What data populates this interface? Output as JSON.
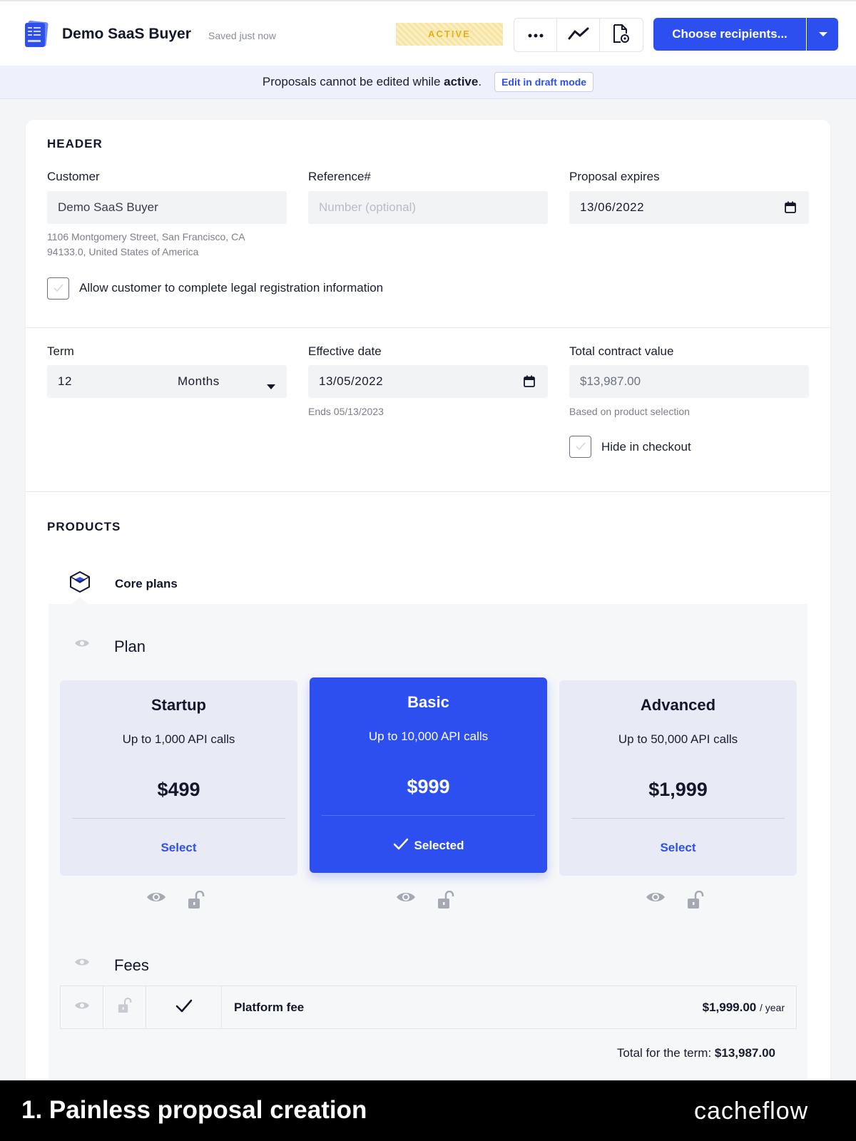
{
  "topbar": {
    "title": "Demo SaaS Buyer",
    "saved_status": "Saved just now",
    "status_badge": "ACTIVE",
    "primary_button": "Choose recipients..."
  },
  "notice": {
    "prefix": "Proposals cannot be edited while",
    "state": "active",
    "suffix": ".",
    "action": "Edit in draft mode"
  },
  "header": {
    "section_title": "HEADER",
    "customer": {
      "label": "Customer",
      "value": "Demo SaaS Buyer",
      "address_line1": "1106 Montgomery Street, San Francisco, CA",
      "address_line2": "94133.0, United States of America"
    },
    "reference": {
      "label": "Reference#",
      "placeholder": "Number (optional)"
    },
    "expires": {
      "label": "Proposal expires",
      "value": "13/06/2022"
    },
    "legal_checkbox_label": "Allow customer to complete legal registration information"
  },
  "term": {
    "label": "Term",
    "value": "12",
    "unit": "Months",
    "effective_label": "Effective date",
    "effective_value": "13/05/2022",
    "ends_hint": "Ends 05/13/2023",
    "tcv_label": "Total contract value",
    "tcv_value": "$13,987.00",
    "tcv_hint": "Based on product selection",
    "hide_checkbox_label": "Hide in checkout"
  },
  "products": {
    "section_title": "PRODUCTS",
    "group_name": "Core plans",
    "plan_heading": "Plan",
    "plans": [
      {
        "name": "Startup",
        "desc": "Up to 1,000 API calls",
        "price": "$499",
        "action": "Select"
      },
      {
        "name": "Basic",
        "desc": "Up to 10,000 API calls",
        "price": "$999",
        "action": "Selected"
      },
      {
        "name": "Advanced",
        "desc": "Up to 50,000 API calls",
        "price": "$1,999",
        "action": "Select"
      }
    ],
    "fees_heading": "Fees",
    "fee": {
      "name": "Platform fee",
      "amount": "$1,999.00",
      "period": "/ year"
    },
    "term_total_label": "Total for the term:",
    "term_total_value": "$13,987.00"
  },
  "footer": {
    "caption": "1. Painless proposal creation",
    "brand": "cacheflow"
  },
  "colors": {
    "accent": "#2e4ff0",
    "badge_text": "#e0b21b",
    "plan_card_bg": "#e8ebf6"
  },
  "icons": [
    "document-stack-icon",
    "more-icon",
    "analytics-icon",
    "preview-icon",
    "caret-down-icon",
    "calendar-icon",
    "check-icon",
    "box-icon",
    "eye-icon",
    "unlock-icon"
  ]
}
